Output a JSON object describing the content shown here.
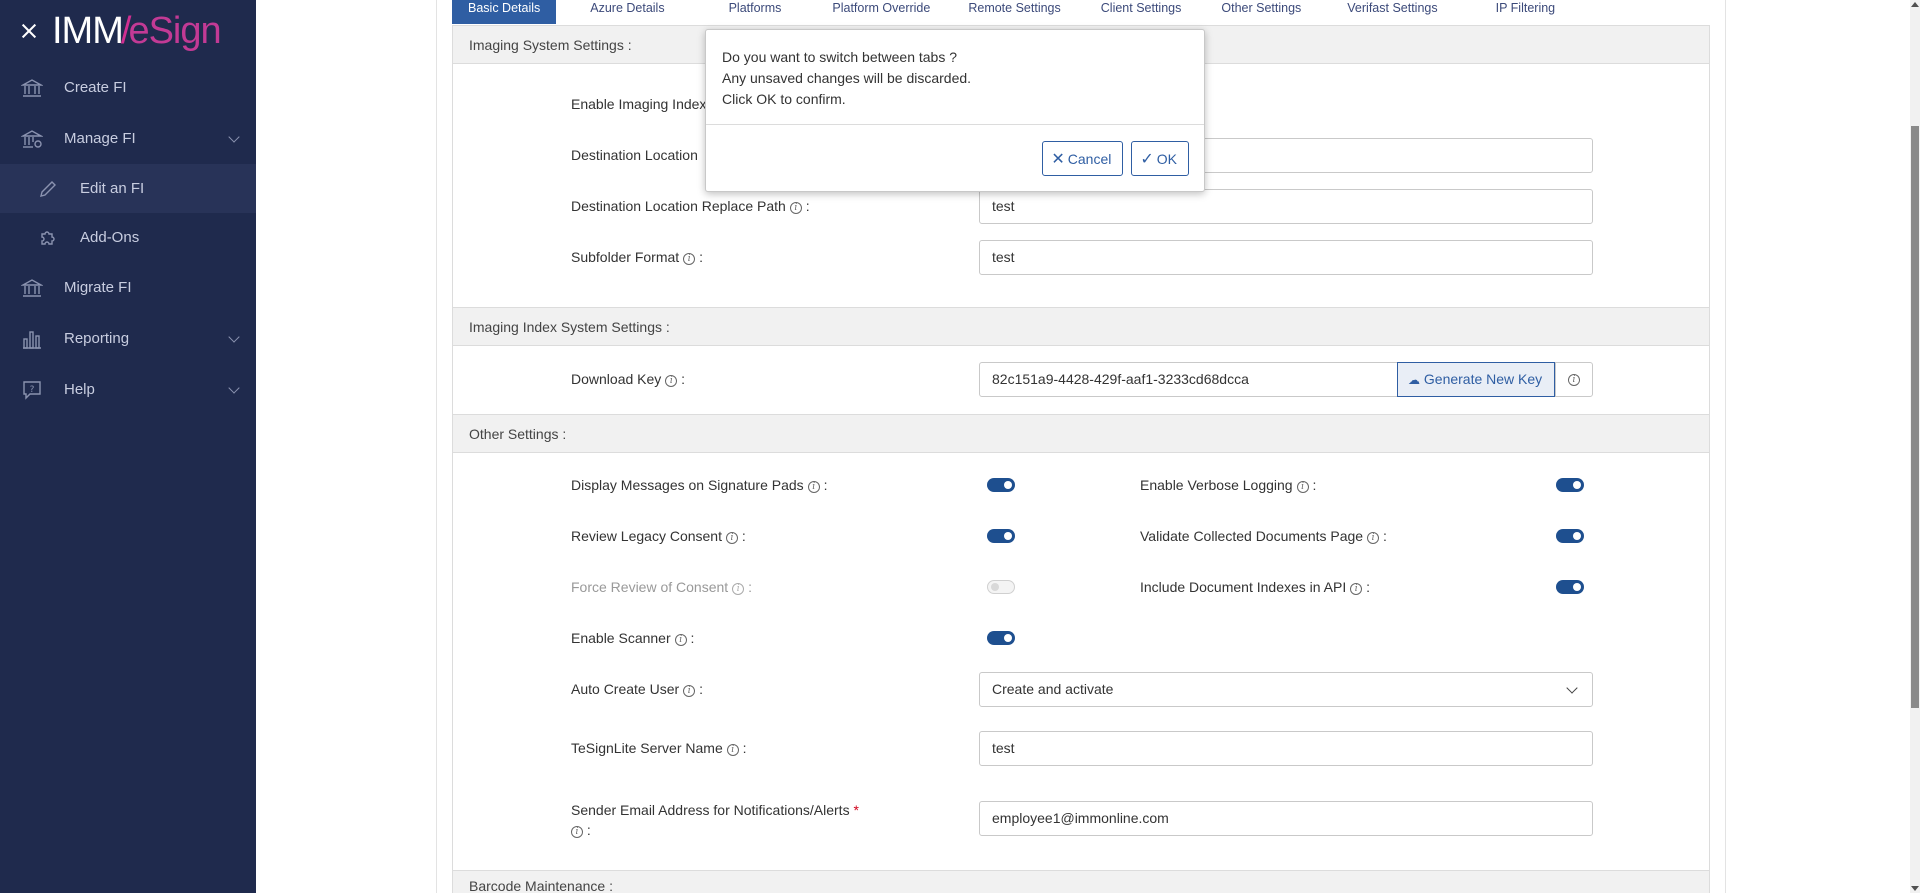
{
  "sidebar": {
    "logo_left": "IMM",
    "logo_right": "eSign",
    "items": [
      {
        "label": "Create FI",
        "icon": "bank-icon"
      },
      {
        "label": "Manage FI",
        "icon": "bank-gear-icon"
      },
      {
        "label": "Edit an FI",
        "icon": "pencil-icon"
      },
      {
        "label": "Add-Ons",
        "icon": "puzzle-icon"
      },
      {
        "label": "Migrate FI",
        "icon": "bank-icon"
      },
      {
        "label": "Reporting",
        "icon": "bar-chart-icon"
      },
      {
        "label": "Help",
        "icon": "help-chat-icon"
      }
    ]
  },
  "tabs": [
    "Basic Details",
    "Azure Details",
    "Platforms",
    "Platform Override",
    "Remote Settings",
    "Client Settings",
    "Other Settings",
    "Verifast Settings",
    "IP Filtering"
  ],
  "imaging": {
    "title": "Imaging System Settings :",
    "enable_label": "Enable Imaging Index",
    "dest_label": "Destination Location",
    "dest_replace_label": "Destination Location Replace Path",
    "dest_replace_value": "test",
    "subfolder_label": "Subfolder Format",
    "subfolder_value": "test"
  },
  "index": {
    "title": "Imaging Index System Settings :",
    "download_label": "Download Key",
    "download_value": "82c151a9-4428-429f-aaf1-3233cd68dcca",
    "generate_label": "Generate New Key"
  },
  "other": {
    "title": "Other Settings :",
    "display_msgs": "Display Messages on Signature Pads",
    "verbose": "Enable Verbose Logging",
    "review_legacy": "Review Legacy Consent",
    "validate_docs": "Validate Collected Documents Page",
    "force_review": "Force Review of Consent",
    "include_indexes": "Include Document Indexes in API",
    "enable_scanner": "Enable Scanner",
    "auto_create": "Auto Create User",
    "auto_create_value": "Create and activate",
    "server_name": "TeSignLite Server Name",
    "server_value": "test",
    "sender_email": "Sender Email Address for Notifications/Alerts",
    "sender_value": "employee1@immonline.com",
    "colon": ":"
  },
  "barcode": {
    "title": "Barcode Maintenance :"
  },
  "modal": {
    "line1": "Do you want to switch between tabs ?",
    "line2": "Any unsaved changes will be discarded.",
    "line3": "Click OK to confirm.",
    "cancel": "Cancel",
    "ok": "OK"
  },
  "colors": {
    "sidebar": "#1f2a4d",
    "accent": "#2f5ea3",
    "toggle_on": "#1e4f8f"
  }
}
